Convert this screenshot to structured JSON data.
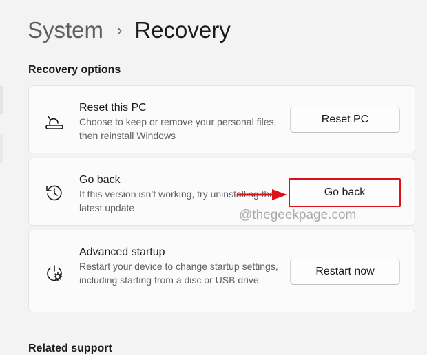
{
  "breadcrumb": {
    "parent": "System",
    "separator": "›",
    "current": "Recovery"
  },
  "recovery_options": {
    "heading": "Recovery options",
    "items": [
      {
        "title": "Reset this PC",
        "description": "Choose to keep or remove your personal files, then reinstall Windows",
        "button": "Reset PC",
        "icon": "reset-pc-icon"
      },
      {
        "title": "Go back",
        "description": "If this version isn’t working, try uninstalling the latest update",
        "button": "Go back",
        "icon": "history-icon"
      },
      {
        "title": "Advanced startup",
        "description": "Restart your device to change startup settings, including starting from a disc or USB drive",
        "button": "Restart now",
        "icon": "advanced-startup-icon"
      }
    ]
  },
  "annotation": {
    "watermark": "@thegeekpage.com",
    "highlight_color": "#e0101a"
  },
  "related_support": {
    "heading": "Related support"
  }
}
